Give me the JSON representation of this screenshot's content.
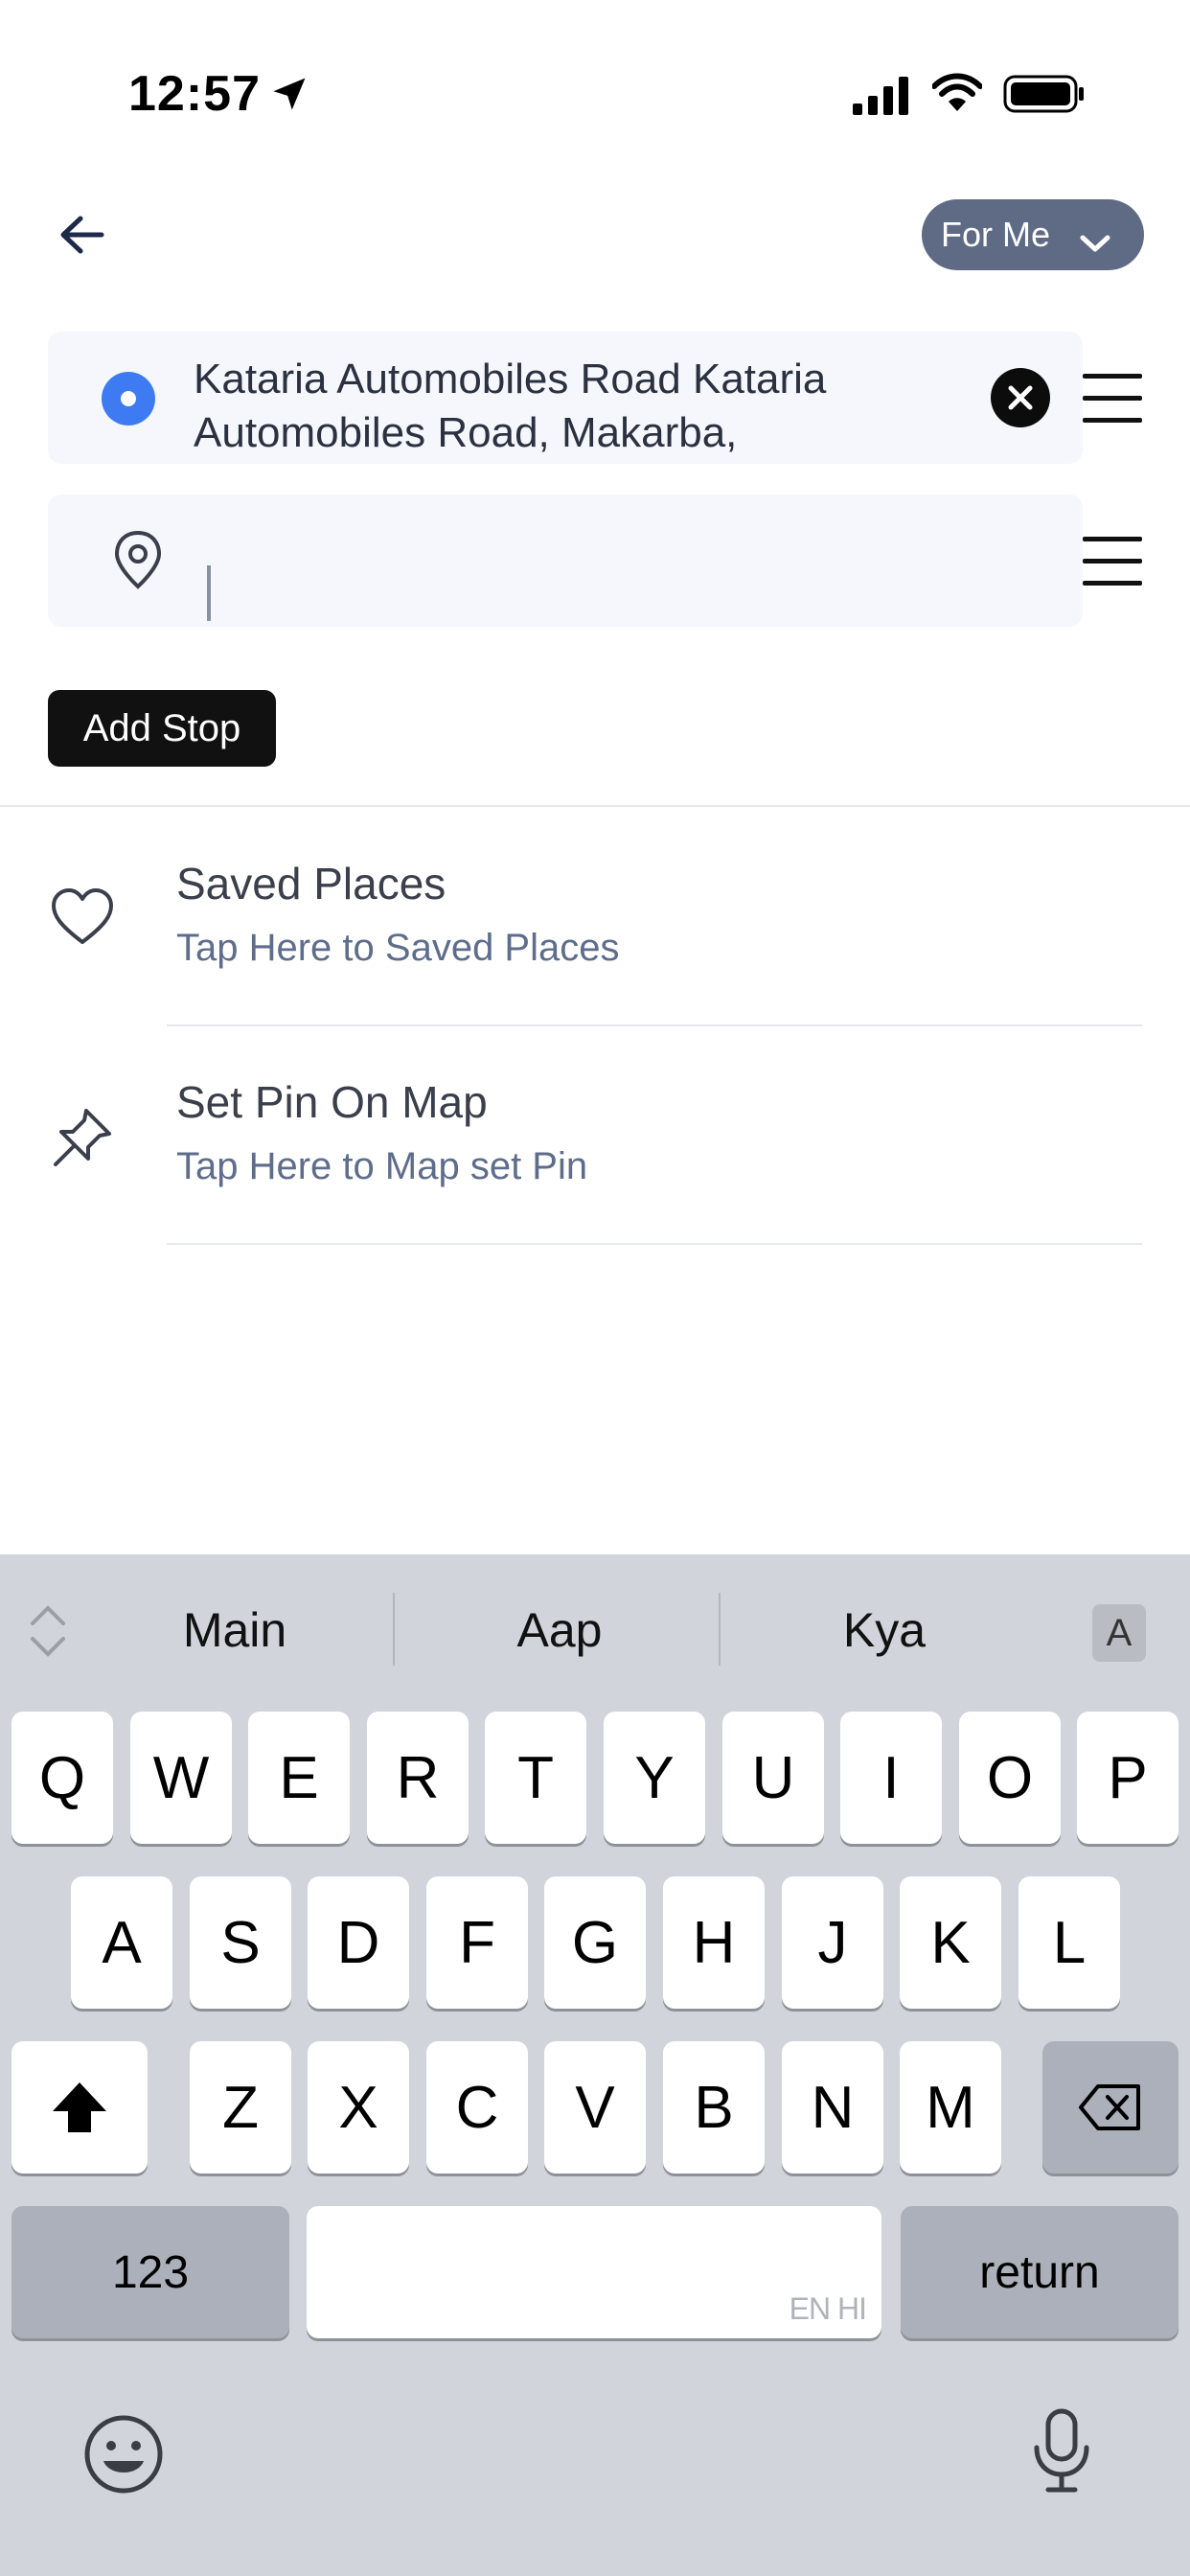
{
  "status_bar": {
    "time": "12:57"
  },
  "header": {
    "for_me_label": "For Me"
  },
  "pickup": {
    "address": "Kataria Automobiles Road Kataria Automobiles Road, Makarba,"
  },
  "drop": {
    "value": ""
  },
  "actions": {
    "add_stop_label": "Add Stop"
  },
  "list": [
    {
      "title": "Saved Places",
      "subtitle": "Tap Here to Saved Places",
      "icon": "heart-icon"
    },
    {
      "title": "Set Pin On Map",
      "subtitle": "Tap Here to Map set Pin",
      "icon": "pin-icon"
    }
  ],
  "keyboard": {
    "suggestions": [
      "Main",
      "Aap",
      "Kya"
    ],
    "lang_badge": "A",
    "row1": [
      "Q",
      "W",
      "E",
      "R",
      "T",
      "Y",
      "U",
      "I",
      "O",
      "P"
    ],
    "row2": [
      "A",
      "S",
      "D",
      "F",
      "G",
      "H",
      "J",
      "K",
      "L"
    ],
    "row3": [
      "Z",
      "X",
      "C",
      "V",
      "B",
      "N",
      "M"
    ],
    "numbers_label": "123",
    "return_label": "return",
    "space_lang": "EN HI"
  },
  "colors": {
    "accent_blue": "#3e7bf2",
    "pill_gray": "#5f6b85",
    "subtitle": "#5e6d8c"
  }
}
